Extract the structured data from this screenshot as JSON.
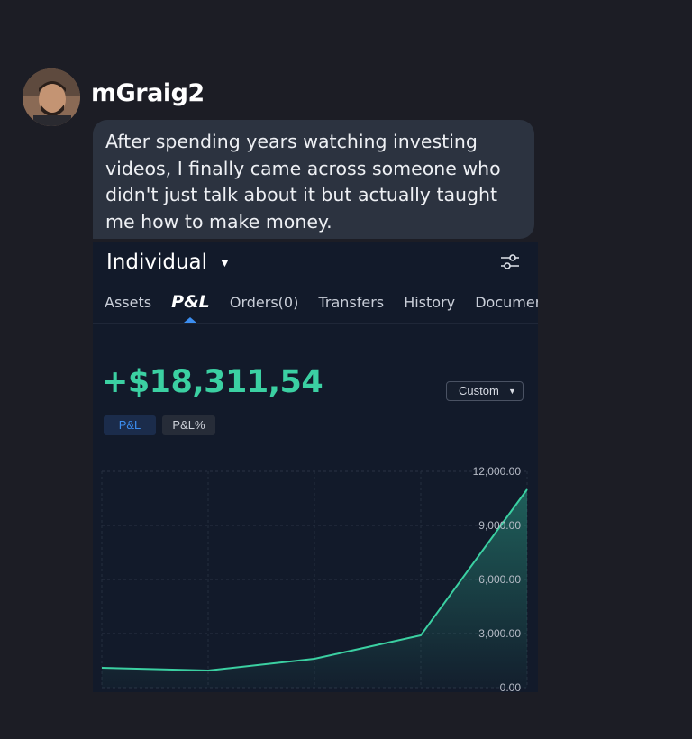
{
  "post": {
    "username": "mGraig2",
    "message": "After spending years watching investing videos, I finally came across someone who didn't just talk about it but actually taught me how to make money."
  },
  "app": {
    "account_title": "Individual",
    "tabs": [
      {
        "label": "Assets"
      },
      {
        "label": "P&L"
      },
      {
        "label": "Orders(0)"
      },
      {
        "label": "Transfers"
      },
      {
        "label": "History"
      },
      {
        "label": "Documen"
      }
    ],
    "active_tab": "P&L",
    "pnl_value": "+$18,311,54",
    "range_selector": "Custom",
    "chips": {
      "pl": "P&L",
      "pl_pct": "P&L%"
    },
    "colors": {
      "accent": "#3bd0a2",
      "tab_active": "#3c8ef0",
      "background": "#121a2a"
    }
  },
  "chart_data": {
    "type": "area",
    "x": [
      0,
      1,
      2,
      3,
      4
    ],
    "values": [
      1100,
      950,
      1600,
      2900,
      11000
    ],
    "y_ticks": [
      "12,000.00",
      "9,000.00",
      "6,000.00",
      "3,000.00",
      "0.00"
    ],
    "ylim": [
      0,
      12000
    ],
    "grid": true
  }
}
